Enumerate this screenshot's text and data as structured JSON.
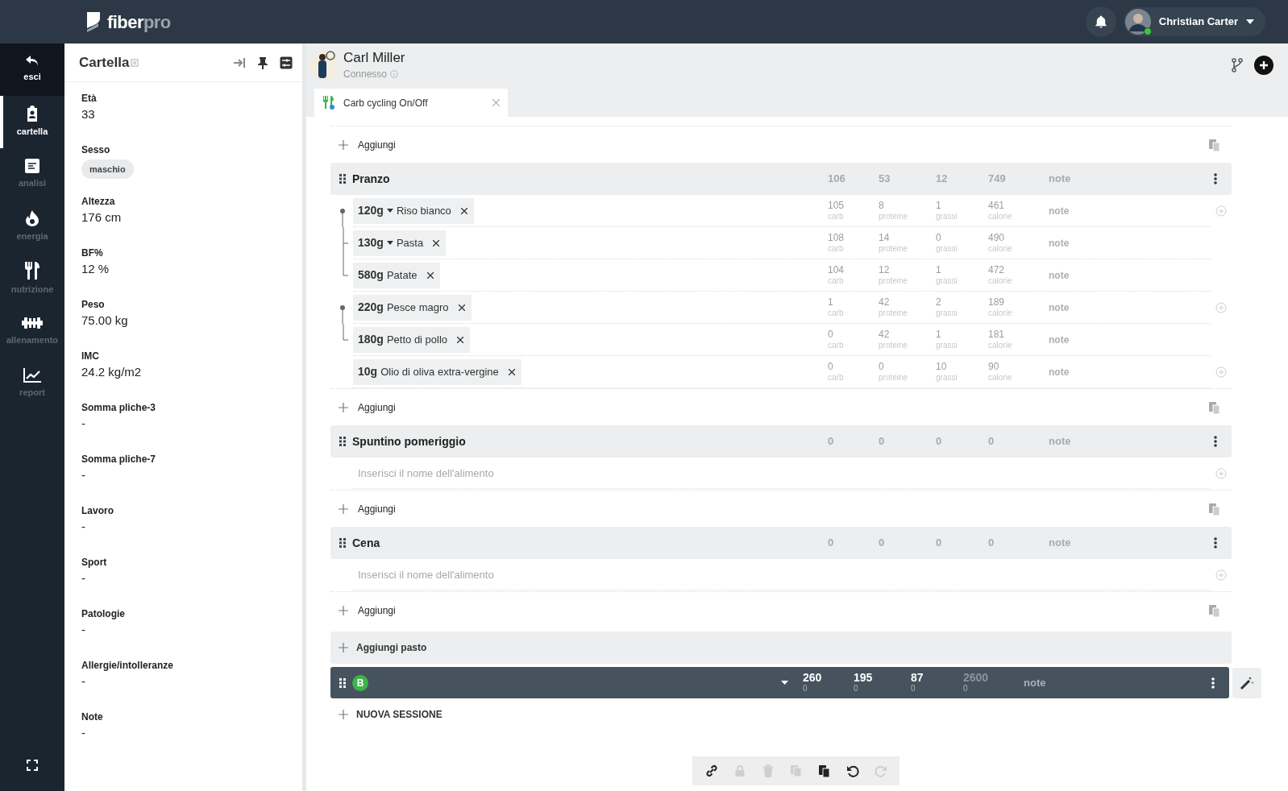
{
  "logo": {
    "primary": "fiber",
    "secondary": "pro"
  },
  "topbar": {
    "user": "Christian Carter",
    "online": true
  },
  "nav": [
    {
      "label": "esci",
      "kind": "back",
      "selected": false
    },
    {
      "label": "cartella",
      "kind": "clipboard",
      "selected": true
    },
    {
      "label": "analisi",
      "kind": "doc",
      "selected": false
    },
    {
      "label": "energia",
      "kind": "flame",
      "selected": false
    },
    {
      "label": "nutrizione",
      "kind": "fork",
      "selected": false
    },
    {
      "label": "allenamento",
      "kind": "dumbbell",
      "selected": false
    },
    {
      "label": "report",
      "kind": "chart",
      "selected": false
    }
  ],
  "panel": {
    "title": "Cartella",
    "fields": [
      {
        "label": "Età",
        "value": "33",
        "kind": "text"
      },
      {
        "label": "Sesso",
        "value": "maschio",
        "kind": "pill"
      },
      {
        "label": "Altezza",
        "value": "176 cm",
        "kind": "text"
      },
      {
        "label": "BF%",
        "value": "12 %",
        "kind": "text"
      },
      {
        "label": "Peso",
        "value": "75.00 kg",
        "kind": "text"
      },
      {
        "label": "IMC",
        "value": "24.2 kg/m2",
        "kind": "text"
      },
      {
        "label": "Somma pliche-3",
        "value": "-",
        "kind": "text"
      },
      {
        "label": "Somma pliche-7",
        "value": "-",
        "kind": "text"
      },
      {
        "label": "Lavoro",
        "value": "-",
        "kind": "text"
      },
      {
        "label": "Sport",
        "value": "-",
        "kind": "text"
      },
      {
        "label": "Patologie",
        "value": "-",
        "kind": "text"
      },
      {
        "label": "Allergie/intolleranze",
        "value": "-",
        "kind": "text"
      },
      {
        "label": "Note",
        "value": "-",
        "kind": "text"
      }
    ]
  },
  "patient": {
    "name": "Carl Miller",
    "status": "Connesso"
  },
  "tabs": [
    {
      "label": "Carb cycling On/Off",
      "selected": true
    }
  ],
  "rows": [
    {
      "kind": "add",
      "label": "Aggiungi"
    },
    {
      "kind": "meal",
      "name": "Pranzo",
      "totals": [
        "106",
        "53",
        "12",
        "749"
      ],
      "note": "note"
    },
    {
      "kind": "group",
      "items": [
        {
          "qty": "120g",
          "dropdown": true,
          "name": "Riso bianco",
          "values": [
            {
              "value": "105",
              "label": "carb"
            },
            {
              "value": "8",
              "label": "proteine"
            },
            {
              "value": "1",
              "label": "grassi"
            },
            {
              "value": "461",
              "label": "calorie"
            }
          ],
          "note": "note"
        },
        {
          "qty": "130g",
          "dropdown": true,
          "name": "Pasta",
          "values": [
            {
              "value": "108",
              "label": "carb"
            },
            {
              "value": "14",
              "label": "proteine"
            },
            {
              "value": "0",
              "label": "grassi"
            },
            {
              "value": "490",
              "label": "calorie"
            }
          ],
          "note": "note"
        },
        {
          "qty": "580g",
          "dropdown": false,
          "name": "Patate",
          "values": [
            {
              "value": "104",
              "label": "carb"
            },
            {
              "value": "12",
              "label": "proteine"
            },
            {
              "value": "1",
              "label": "grassi"
            },
            {
              "value": "472",
              "label": "calorie"
            }
          ],
          "note": "note"
        }
      ]
    },
    {
      "kind": "group",
      "items": [
        {
          "qty": "220g",
          "dropdown": false,
          "name": "Pesce magro",
          "values": [
            {
              "value": "1",
              "label": "carb"
            },
            {
              "value": "42",
              "label": "proteine"
            },
            {
              "value": "2",
              "label": "grassi"
            },
            {
              "value": "189",
              "label": "calorie"
            }
          ],
          "note": "note"
        },
        {
          "qty": "180g",
          "dropdown": false,
          "name": "Petto di pollo",
          "values": [
            {
              "value": "0",
              "label": "carb"
            },
            {
              "value": "42",
              "label": "proteine"
            },
            {
              "value": "1",
              "label": "grassi"
            },
            {
              "value": "181",
              "label": "calorie"
            }
          ],
          "note": "note"
        }
      ]
    },
    {
      "kind": "group",
      "items": [
        {
          "qty": "10g",
          "dropdown": false,
          "name": "Olio di oliva extra-vergine",
          "values": [
            {
              "value": "0",
              "label": "carb"
            },
            {
              "value": "0",
              "label": "proteine"
            },
            {
              "value": "10",
              "label": "grassi"
            },
            {
              "value": "90",
              "label": "calorie"
            }
          ],
          "note": "note"
        }
      ]
    },
    {
      "kind": "add",
      "label": "Aggiungi"
    },
    {
      "kind": "meal",
      "name": "Spuntino pomeriggio",
      "totals": [
        "0",
        "0",
        "0",
        "0"
      ],
      "note": "note"
    },
    {
      "kind": "placeholder",
      "placeholder": "Inserisci il nome dell'alimento"
    },
    {
      "kind": "add",
      "label": "Aggiungi"
    },
    {
      "kind": "meal",
      "name": "Cena",
      "totals": [
        "0",
        "0",
        "0",
        "0"
      ],
      "note": "note"
    },
    {
      "kind": "placeholder",
      "placeholder": "Inserisci il nome dell'alimento"
    },
    {
      "kind": "add",
      "label": "Aggiungi"
    },
    {
      "kind": "add_meal",
      "label": "Aggiungi pasto"
    }
  ],
  "session": {
    "badge": "B",
    "totals": [
      {
        "value": "260",
        "sub": "0",
        "dimmed": false
      },
      {
        "value": "195",
        "sub": "0",
        "dimmed": false
      },
      {
        "value": "87",
        "sub": "0",
        "dimmed": false
      },
      {
        "value": "2600",
        "sub": "0",
        "dimmed": true
      }
    ],
    "note": "note"
  },
  "new_session": "NUOVA SESSIONE",
  "toolbar": [
    {
      "kind": "link",
      "disabled": false
    },
    {
      "kind": "lock",
      "disabled": true
    },
    {
      "kind": "trash",
      "disabled": true
    },
    {
      "kind": "copy",
      "disabled": true
    },
    {
      "kind": "paste",
      "disabled": false
    },
    {
      "kind": "undo",
      "disabled": false
    },
    {
      "kind": "redo",
      "disabled": true
    }
  ]
}
